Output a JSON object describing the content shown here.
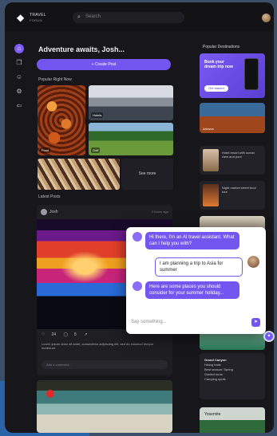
{
  "header": {
    "logo_text": "TRAVEL",
    "logo_sub": "FORUM",
    "search_placeholder": "Search"
  },
  "rail": [
    "home-icon",
    "bookmark-icon",
    "user-icon",
    "gear-icon",
    "logout-icon"
  ],
  "main": {
    "title": "Adventure awaits, Josh...",
    "create_label": "+ Create Post",
    "section_top": "Popular Right Now",
    "tiles": [
      "Food",
      "Hotels",
      "Golf"
    ],
    "see_more": "See more",
    "section_posts": "Latest Posts",
    "post": {
      "name": "Josh",
      "time": "2 hours ago",
      "likes": "24",
      "comments": "5",
      "desc": "Lorem ipsum dolor sit amet, consectetur adipiscing elit, sed do eiusmod tempor incididunt.",
      "comment_placeholder": "Add a comment..."
    }
  },
  "right": {
    "title": "Popular Destinations",
    "promo_title": "Book your dream trip now",
    "promo_button": "Get started",
    "card1": "Arizona",
    "row1": "Hotel resort with ocean view and pool",
    "row2": "Night market street food tour",
    "info_title": "Grand Canyon",
    "info_lines": [
      "Hiking trails",
      "Best season: Spring",
      "Guided tours",
      "Camping spots"
    ],
    "last_label": "Yosemite"
  },
  "chat": {
    "msg1": "Hi there, I'm an AI travel assistant. What can I help you with?",
    "msg2": "I am planning a trip to Asia for summer",
    "msg3": "Here are some places you should consider for your summer holiday...",
    "input_placeholder": "Say something...",
    "send_icon": "send-icon"
  },
  "colors": {
    "accent": "#7356f0",
    "background": "#17171b"
  }
}
